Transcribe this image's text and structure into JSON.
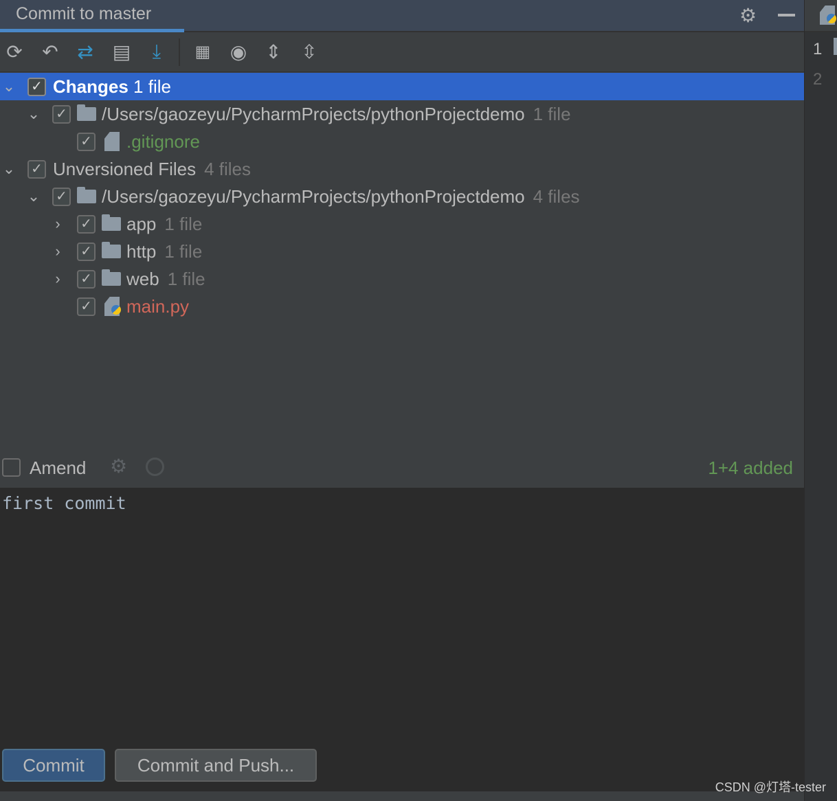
{
  "header": {
    "tab_title": "Commit to master",
    "settings_icon": "gear-icon",
    "minimize_icon": "minimize-icon"
  },
  "toolbar": {
    "items": [
      "refresh-icon",
      "rollback-icon",
      "diff-icon",
      "shelve-icon",
      "update-icon",
      "group-by-icon",
      "view-options-icon",
      "expand-all-icon",
      "collapse-all-icon"
    ]
  },
  "tree": {
    "changes": {
      "label": "Changes",
      "count": "1 file"
    },
    "changes_dir": {
      "label": "/Users/gaozeyu/PycharmProjects/pythonProjectdemo",
      "count": "1 file"
    },
    "gitignore": {
      "label": ".gitignore",
      "color": "#629755"
    },
    "unversioned": {
      "label": "Unversioned Files",
      "count": "4 files"
    },
    "unv_dir": {
      "label": "/Users/gaozeyu/PycharmProjects/pythonProjectdemo",
      "count": "4 files"
    },
    "folders": [
      {
        "label": "app",
        "count": "1 file"
      },
      {
        "label": "http",
        "count": "1 file"
      },
      {
        "label": "web",
        "count": "1 file"
      }
    ],
    "main": {
      "label": "main.py",
      "color": "#d1675a"
    }
  },
  "amend": {
    "label": "Amend",
    "checked": false,
    "status": "1+4 added",
    "status_color": "#629755"
  },
  "editor": {
    "message": "first commit"
  },
  "gutter": {
    "lines": [
      "1",
      "2"
    ]
  },
  "buttons": {
    "commit": "Commit",
    "commit_push": "Commit and Push..."
  },
  "watermark": "CSDN @灯塔-tester"
}
